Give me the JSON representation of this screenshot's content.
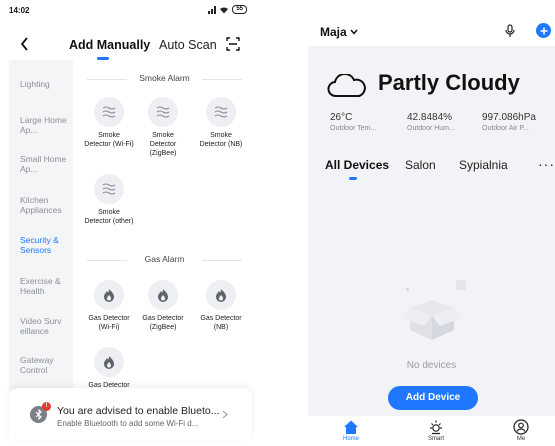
{
  "left": {
    "status_time": "14:02",
    "battery": "55",
    "tabs": {
      "manual": "Add Manually",
      "auto": "Auto Scan"
    },
    "categories": [
      {
        "label": "Lighting",
        "active": false
      },
      {
        "label": "Large Home Ap...",
        "active": false
      },
      {
        "label": "Small Home Ap...",
        "active": false
      },
      {
        "label": "Kitchen Appliances",
        "active": false
      },
      {
        "label": "Security & Sensors",
        "active": true
      },
      {
        "label": "Exercise & Health",
        "active": false
      },
      {
        "label": "Video Surv eillance",
        "active": false
      },
      {
        "label": "Gateway Control",
        "active": false
      }
    ],
    "sections": [
      {
        "title": "Smoke Alarm",
        "devices": [
          {
            "label": "Smoke Detector (Wi-Fi)",
            "icon": "smoke-icon"
          },
          {
            "label": "Smoke Detector (ZigBee)",
            "icon": "smoke-icon"
          },
          {
            "label": "Smoke Detector (NB)",
            "icon": "smoke-icon"
          },
          {
            "label": "Smoke Detector (other)",
            "icon": "smoke-icon"
          }
        ]
      },
      {
        "title": "Gas Alarm",
        "devices": [
          {
            "label": "Gas Detector (Wi-Fi)",
            "icon": "flame-icon"
          },
          {
            "label": "Gas Detector (ZigBee)",
            "icon": "flame-icon"
          },
          {
            "label": "Gas Detector (NB)",
            "icon": "flame-icon"
          },
          {
            "label": "Gas Detector",
            "icon": "flame-icon"
          }
        ]
      }
    ],
    "bluetooth": {
      "badge": "!",
      "title": "You are advised to enable Blueto...",
      "subtitle": "Enable Bluetooth to add some Wi-Fi d..."
    }
  },
  "right": {
    "home_name": "Maja",
    "weather": "Partly Cloudy",
    "stats": [
      {
        "value": "26°C",
        "label": "Outdoor Tem..."
      },
      {
        "value": "42.8484%",
        "label": "Outdoor Hum..."
      },
      {
        "value": "997.086hPa",
        "label": "Outdoor Air P..."
      }
    ],
    "rooms": [
      {
        "label": "All Devices",
        "active": true
      },
      {
        "label": "Salon",
        "active": false
      },
      {
        "label": "Sypialnia",
        "active": false
      }
    ],
    "more": "···",
    "empty_text": "No devices",
    "add_device": "Add Device",
    "nav": [
      {
        "label": "Home",
        "icon": "home-icon",
        "active": true
      },
      {
        "label": "Smart",
        "icon": "sun-icon",
        "active": false
      },
      {
        "label": "Me",
        "icon": "user-icon",
        "active": false
      }
    ]
  },
  "colors": {
    "accent": "#1f78ff",
    "alert": "#e53935"
  }
}
